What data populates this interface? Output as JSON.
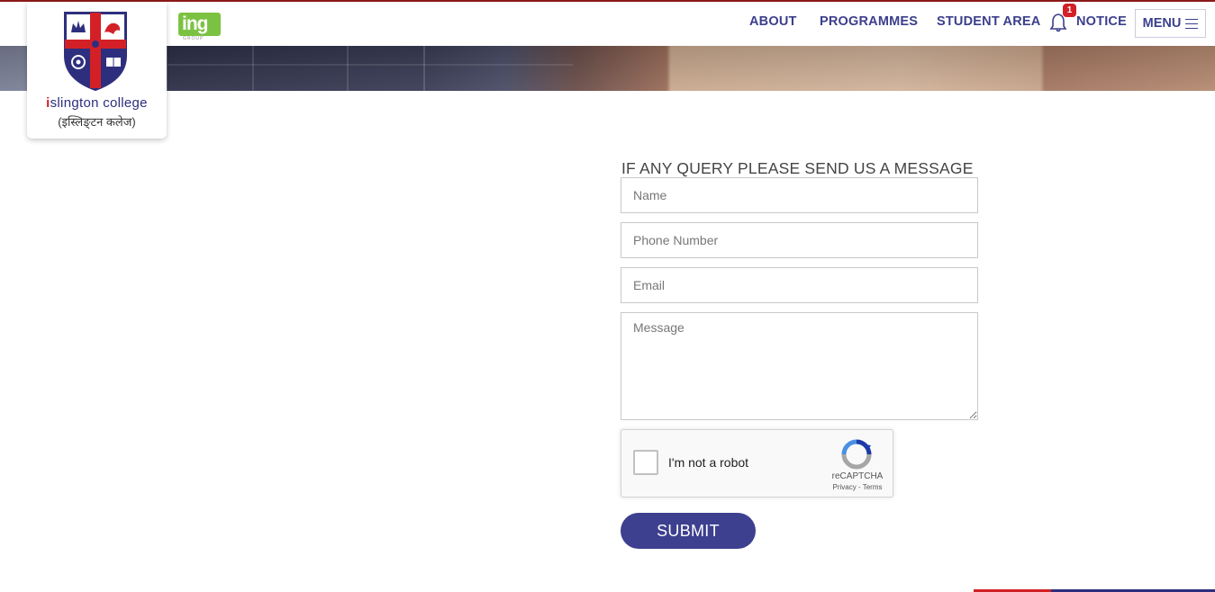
{
  "header": {
    "logo": {
      "name_prefix": "i",
      "name_rest": "slington college",
      "name_nepali": "(इस्लिङ्टन कलेज)"
    },
    "partner_logo": {
      "text": "ing",
      "subtext": "GROUP"
    },
    "nav": {
      "about": "ABOUT",
      "programmes": "PROGRAMMES",
      "student_area": "STUDENT AREA",
      "notice": "NOTICE",
      "notice_badge": "1",
      "menu": "MENU"
    }
  },
  "form": {
    "title": "IF ANY QUERY PLEASE SEND US A MESSAGE",
    "name_placeholder": "Name",
    "phone_placeholder": "Phone Number",
    "email_placeholder": "Email",
    "message_placeholder": "Message",
    "captcha": {
      "label": "I'm not a robot",
      "brand": "reCAPTCHA",
      "links": "Privacy - Terms"
    },
    "submit_label": "SUBMIT"
  },
  "colors": {
    "brand_blue": "#3d3f8f",
    "brand_red": "#d32027",
    "partner_green": "#7cc242"
  }
}
